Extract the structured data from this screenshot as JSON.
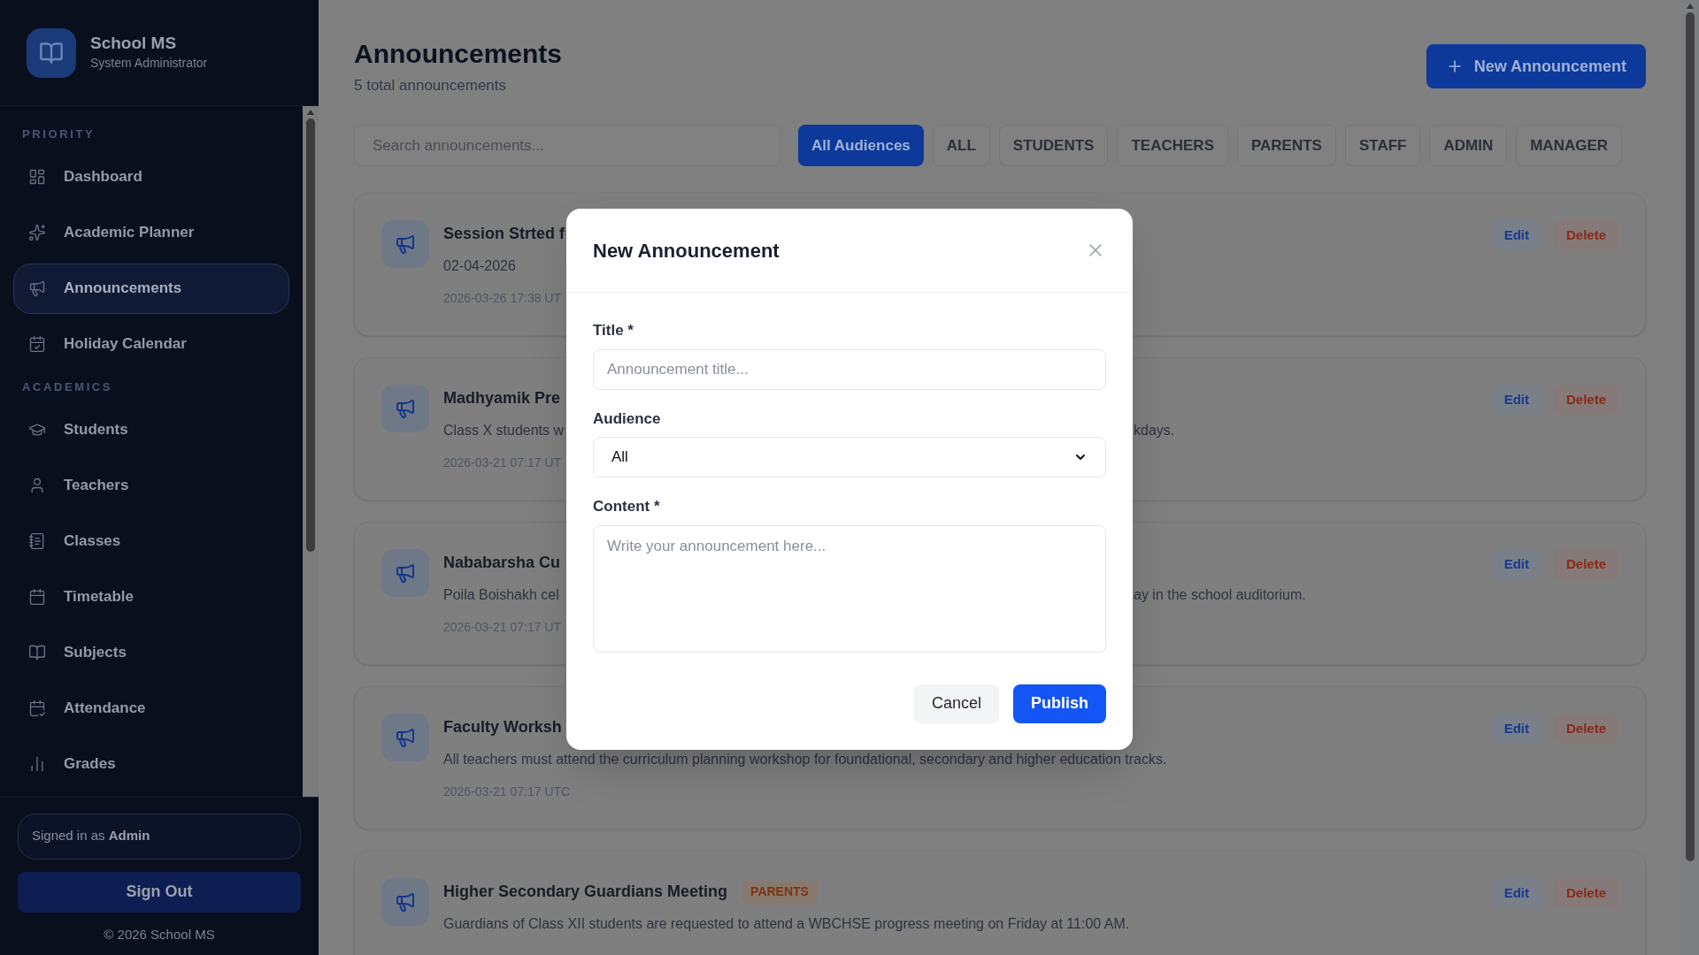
{
  "brand": {
    "name": "School MS",
    "role": "System Administrator"
  },
  "sidebar": {
    "sections": [
      {
        "heading": "PRIORITY",
        "items": [
          {
            "label": "Dashboard",
            "selected": false
          },
          {
            "label": "Academic Planner",
            "selected": false
          },
          {
            "label": "Announcements",
            "selected": true
          },
          {
            "label": "Holiday Calendar",
            "selected": false
          }
        ]
      },
      {
        "heading": "ACADEMICS",
        "items": [
          {
            "label": "Students",
            "selected": false
          },
          {
            "label": "Teachers",
            "selected": false
          },
          {
            "label": "Classes",
            "selected": false
          },
          {
            "label": "Timetable",
            "selected": false
          },
          {
            "label": "Subjects",
            "selected": false
          },
          {
            "label": "Attendance",
            "selected": false
          },
          {
            "label": "Grades",
            "selected": false
          }
        ]
      }
    ],
    "signed_in": {
      "prefix": "Signed in as",
      "user": "Admin"
    },
    "sign_out": "Sign Out",
    "footer": "© 2026 School MS"
  },
  "page": {
    "title": "Announcements",
    "subtitle": "5 total announcements",
    "new_button": "New Announcement",
    "search": {
      "placeholder": "Search announcements..."
    },
    "filters": [
      {
        "label": "All Audiences",
        "selected": true
      },
      {
        "label": "ALL",
        "selected": false
      },
      {
        "label": "STUDENTS",
        "selected": false
      },
      {
        "label": "TEACHERS",
        "selected": false
      },
      {
        "label": "PARENTS",
        "selected": false
      },
      {
        "label": "STAFF",
        "selected": false
      },
      {
        "label": "ADMIN",
        "selected": false
      },
      {
        "label": "MANAGER",
        "selected": false
      }
    ],
    "announcements": [
      {
        "title": "Session Strted f",
        "body": "02-04-2026",
        "date": "2026-03-26 17:38 UT",
        "edit": "Edit",
        "delete": "Delete"
      },
      {
        "title": "Madhyamik Pre",
        "body": "Class X students w",
        "body_tail": "kdays.",
        "date": "2026-03-21 07:17 UT",
        "edit": "Edit",
        "delete": "Delete"
      },
      {
        "title": "Nababarsha Cu",
        "body": "Poila Boishakh cel",
        "body_tail": "ay in the school auditorium.",
        "date": "2026-03-21 07:17 UT",
        "edit": "Edit",
        "delete": "Delete"
      },
      {
        "title": "Faculty Worksh",
        "body": "All teachers must attend the curriculum planning workshop for foundational, secondary and higher education tracks.",
        "date": "2026-03-21 07:17 UTC",
        "edit": "Edit",
        "delete": "Delete"
      },
      {
        "title": "Higher Secondary Guardians Meeting",
        "badge": "PARENTS",
        "body": "Guardians of Class XII students are requested to attend a WBCHSE progress meeting on Friday at 11:00 AM.",
        "edit": "Edit",
        "delete": "Delete"
      }
    ]
  },
  "dialog": {
    "title": "New Announcement",
    "fields": [
      {
        "kind": "text",
        "label": "Title *",
        "placeholder": "Announcement title..."
      },
      {
        "kind": "select",
        "label": "Audience",
        "value": "All"
      },
      {
        "kind": "textarea",
        "label": "Content *",
        "placeholder": "Write your announcement here..."
      }
    ],
    "cancel": "Cancel",
    "publish": "Publish"
  }
}
